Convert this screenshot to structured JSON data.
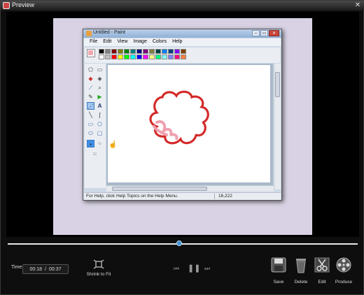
{
  "window": {
    "title": "Preview",
    "close_glyph": "✕"
  },
  "paint": {
    "title": "Untitled - Paint",
    "menu": [
      "File",
      "Edit",
      "View",
      "Image",
      "Colors",
      "Help"
    ],
    "palette": [
      "#000000",
      "#808080",
      "#800000",
      "#808000",
      "#008000",
      "#008080",
      "#000080",
      "#800080",
      "#808040",
      "#004040",
      "#0080ff",
      "#004080",
      "#8000ff",
      "#804000",
      "#ffffff",
      "#c0c0c0",
      "#ff0000",
      "#ffff00",
      "#00ff00",
      "#00ffff",
      "#0000ff",
      "#ff00ff",
      "#ffff80",
      "#00ff80",
      "#80ffff",
      "#8080ff",
      "#ff0080",
      "#ff8040"
    ],
    "current_color": "#f2a7ae",
    "status_help": "For Help, click Help Topics on the Help Menu.",
    "status_coords": "16,222",
    "window_buttons": {
      "minimize": "‒",
      "maximize": "▭",
      "close": "✕"
    }
  },
  "controls": {
    "time_label": "Time",
    "current_time": "00:18",
    "time_separator": "/",
    "total_time": "00:37",
    "progress": 0.49,
    "shrink_label": "Shrink to Fit",
    "transport": {
      "prev": "⏮",
      "pause": "❚❚",
      "next": "⏭"
    },
    "actions": [
      {
        "label": "Save"
      },
      {
        "label": "Delete"
      },
      {
        "label": "Edit"
      },
      {
        "label": "Produce"
      }
    ]
  },
  "colors": {
    "accent": "#3b8fd8",
    "canvas_bg": "#d8d2e4",
    "stroke_red": "#d42a2a",
    "stroke_pink": "#f0a0b0"
  }
}
